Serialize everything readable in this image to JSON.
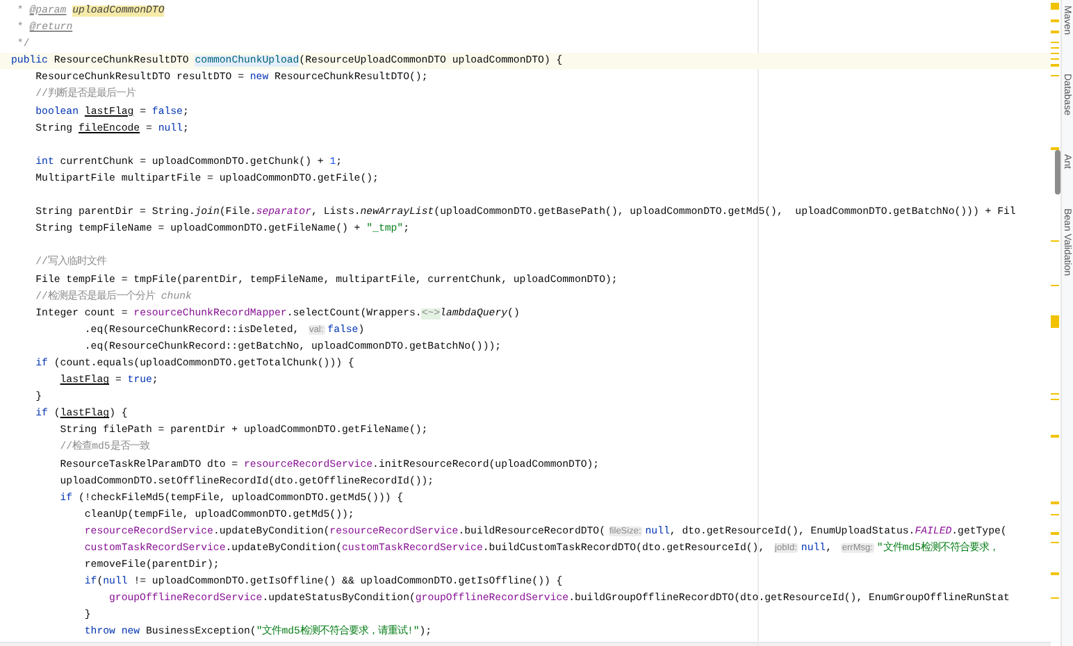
{
  "editor": {
    "lines": [
      {
        "current": false,
        "tokens": [
          {
            "kind": "comment",
            "text": " * "
          },
          {
            "kind": "doctag",
            "text": "@param"
          },
          {
            "kind": "docref",
            "text": " uploadCommonDTO"
          }
        ]
      },
      {
        "current": false,
        "tokens": [
          {
            "kind": "comment",
            "text": " * "
          },
          {
            "kind": "doctag",
            "text": "@return"
          }
        ]
      },
      {
        "current": false,
        "tokens": [
          {
            "kind": "comment",
            "text": " */"
          }
        ]
      },
      {
        "current": true,
        "tokens": [
          {
            "kind": "keyword",
            "text": "public"
          },
          {
            "kind": "plain",
            "text": " ResourceChunkResultDTO "
          },
          {
            "kind": "decl",
            "text": "commonChunkUpload"
          },
          {
            "kind": "plain",
            "text": "(ResourceUploadCommonDTO uploadCommonDTO) {"
          }
        ]
      },
      {
        "current": false,
        "tokens": [
          {
            "kind": "plain",
            "text": "    ResourceChunkResultDTO resultDTO = "
          },
          {
            "kind": "keyword",
            "text": "new"
          },
          {
            "kind": "plain",
            "text": " ResourceChunkResultDTO();"
          }
        ]
      },
      {
        "current": false,
        "tokens": [
          {
            "kind": "comment",
            "text": "    //判断是否是最后一片"
          }
        ]
      },
      {
        "current": false,
        "tokens": [
          {
            "kind": "keyword",
            "text": "    boolean "
          },
          {
            "kind": "underline",
            "text": "lastFlag"
          },
          {
            "kind": "plain",
            "text": " = "
          },
          {
            "kind": "keyword",
            "text": "false"
          },
          {
            "kind": "plain",
            "text": ";"
          }
        ]
      },
      {
        "current": false,
        "tokens": [
          {
            "kind": "plain",
            "text": "    String "
          },
          {
            "kind": "underline",
            "text": "fileEncode"
          },
          {
            "kind": "plain",
            "text": " = "
          },
          {
            "kind": "keyword",
            "text": "null"
          },
          {
            "kind": "plain",
            "text": ";"
          }
        ]
      },
      {
        "current": false
      },
      {
        "current": false,
        "tokens": [
          {
            "kind": "keyword",
            "text": "    int"
          },
          {
            "kind": "plain",
            "text": " currentChunk = uploadCommonDTO.getChunk() + "
          },
          {
            "kind": "number",
            "text": "1"
          },
          {
            "kind": "plain",
            "text": ";"
          }
        ]
      },
      {
        "current": false,
        "tokens": [
          {
            "kind": "plain",
            "text": "    MultipartFile multipartFile = uploadCommonDTO.getFile();"
          }
        ]
      },
      {
        "current": false
      },
      {
        "current": false,
        "tokens": [
          {
            "kind": "plain",
            "text": "    String parentDir = String."
          },
          {
            "kind": "static",
            "text": "join"
          },
          {
            "kind": "plain",
            "text": "(File."
          },
          {
            "kind": "static_field",
            "text": "separator"
          },
          {
            "kind": "plain",
            "text": ", Lists."
          },
          {
            "kind": "static",
            "text": "newArrayList"
          },
          {
            "kind": "plain",
            "text": "(uploadCommonDTO.getBasePath(), uploadCommonDTO.getMd5(),  uploadCommonDTO.getBatchNo())) + Fil"
          }
        ]
      },
      {
        "current": false,
        "tokens": [
          {
            "kind": "plain",
            "text": "    String tempFileName = uploadCommonDTO.getFileName() + "
          },
          {
            "kind": "string",
            "text": "\"_tmp\""
          },
          {
            "kind": "plain",
            "text": ";"
          }
        ]
      },
      {
        "current": false
      },
      {
        "current": false,
        "tokens": [
          {
            "kind": "comment",
            "text": "    //写入临时文件"
          }
        ]
      },
      {
        "current": false,
        "tokens": [
          {
            "kind": "plain",
            "text": "    File tempFile = tmpFile(parentDir, tempFileName, multipartFile, currentChunk, uploadCommonDTO);"
          }
        ]
      },
      {
        "current": false,
        "tokens": [
          {
            "kind": "comment",
            "text": "    //检测是否是最后一个分片 "
          },
          {
            "kind": "comment_em",
            "text": "chunk"
          }
        ]
      },
      {
        "current": false,
        "tokens": [
          {
            "kind": "plain",
            "text": "    Integer count = "
          },
          {
            "kind": "field",
            "text": "resourceChunkRecordMapper"
          },
          {
            "kind": "plain",
            "text": ".selectCount(Wrappers."
          },
          {
            "kind": "infer",
            "text": "<~>"
          },
          {
            "kind": "static",
            "text": "lambdaQuery"
          },
          {
            "kind": "plain",
            "text": "()"
          }
        ]
      },
      {
        "current": false,
        "tokens": [
          {
            "kind": "plain",
            "text": "            .eq(ResourceChunkRecord::isDeleted, "
          },
          {
            "kind": "hint",
            "text": "val:"
          },
          {
            "kind": "keyword",
            "text": "false"
          },
          {
            "kind": "plain",
            "text": ")"
          }
        ]
      },
      {
        "current": false,
        "tokens": [
          {
            "kind": "plain",
            "text": "            .eq(ResourceChunkRecord::getBatchNo, uploadCommonDTO.getBatchNo()));"
          }
        ]
      },
      {
        "current": false,
        "tokens": [
          {
            "kind": "keyword",
            "text": "    if"
          },
          {
            "kind": "plain",
            "text": " (count.equals(uploadCommonDTO.getTotalChunk())) {"
          }
        ]
      },
      {
        "current": false,
        "tokens": [
          {
            "kind": "underline",
            "text": "        lastFlag"
          },
          {
            "kind": "plain",
            "text": " = "
          },
          {
            "kind": "keyword",
            "text": "true"
          },
          {
            "kind": "plain",
            "text": ";"
          }
        ]
      },
      {
        "current": false,
        "tokens": [
          {
            "kind": "plain",
            "text": "    }"
          }
        ]
      },
      {
        "current": false,
        "tokens": [
          {
            "kind": "keyword",
            "text": "    if"
          },
          {
            "kind": "plain",
            "text": " ("
          },
          {
            "kind": "underline",
            "text": "lastFlag"
          },
          {
            "kind": "plain",
            "text": ") {"
          }
        ]
      },
      {
        "current": false,
        "tokens": [
          {
            "kind": "plain",
            "text": "        String filePath = parentDir + uploadCommonDTO.getFileName();"
          }
        ]
      },
      {
        "current": false,
        "tokens": [
          {
            "kind": "comment",
            "text": "        //检查md5是否一致"
          }
        ]
      },
      {
        "current": false,
        "tokens": [
          {
            "kind": "plain",
            "text": "        ResourceTaskRelParamDTO dto = "
          },
          {
            "kind": "field",
            "text": "resourceRecordService"
          },
          {
            "kind": "plain",
            "text": ".initResourceRecord(uploadCommonDTO);"
          }
        ]
      },
      {
        "current": false,
        "tokens": [
          {
            "kind": "plain",
            "text": "        uploadCommonDTO.setOfflineRecordId(dto.getOfflineRecordId());"
          }
        ]
      },
      {
        "current": false,
        "tokens": [
          {
            "kind": "keyword",
            "text": "        if"
          },
          {
            "kind": "plain",
            "text": " (!checkFileMd5(tempFile, uploadCommonDTO.getMd5())) {"
          }
        ]
      },
      {
        "current": false,
        "tokens": [
          {
            "kind": "plain",
            "text": "            cleanUp(tempFile, uploadCommonDTO.getMd5());"
          }
        ]
      },
      {
        "current": false,
        "tokens": [
          {
            "kind": "field",
            "text": "            resourceRecordService"
          },
          {
            "kind": "plain",
            "text": ".updateByCondition("
          },
          {
            "kind": "field",
            "text": "resourceRecordService"
          },
          {
            "kind": "plain",
            "text": ".buildResourceRecordDTO("
          },
          {
            "kind": "hint",
            "text": "fileSize:"
          },
          {
            "kind": "keyword",
            "text": "null"
          },
          {
            "kind": "plain",
            "text": ", dto.getResourceId(), EnumUploadStatus."
          },
          {
            "kind": "static_field",
            "text": "FAILED"
          },
          {
            "kind": "plain",
            "text": ".getType("
          }
        ]
      },
      {
        "current": false,
        "tokens": [
          {
            "kind": "field",
            "text": "            customTaskRecordService"
          },
          {
            "kind": "plain",
            "text": ".updateByCondition("
          },
          {
            "kind": "field",
            "text": "customTaskRecordService"
          },
          {
            "kind": "plain",
            "text": ".buildCustomTaskRecordDTO(dto.getResourceId(), "
          },
          {
            "kind": "hint",
            "text": "jobId:"
          },
          {
            "kind": "keyword",
            "text": "null"
          },
          {
            "kind": "plain",
            "text": ", "
          },
          {
            "kind": "hint",
            "text": "errMsg:"
          },
          {
            "kind": "string",
            "text": "\"文件md5检测不符合要求，"
          }
        ]
      },
      {
        "current": false,
        "tokens": [
          {
            "kind": "plain",
            "text": "            removeFile(parentDir);"
          }
        ]
      },
      {
        "current": false,
        "tokens": [
          {
            "kind": "keyword",
            "text": "            if"
          },
          {
            "kind": "plain",
            "text": "("
          },
          {
            "kind": "keyword",
            "text": "null"
          },
          {
            "kind": "plain",
            "text": " != uploadCommonDTO.getIsOffline() && uploadCommonDTO.getIsOffline()) {"
          }
        ]
      },
      {
        "current": false,
        "tokens": [
          {
            "kind": "field",
            "text": "                groupOfflineRecordService"
          },
          {
            "kind": "plain",
            "text": ".updateStatusByCondition("
          },
          {
            "kind": "field",
            "text": "groupOfflineRecordService"
          },
          {
            "kind": "plain",
            "text": ".buildGroupOfflineRecordDTO(dto.getResourceId(), EnumGroupOfflineRunStat"
          }
        ]
      },
      {
        "current": false,
        "tokens": [
          {
            "kind": "plain",
            "text": "            }"
          }
        ]
      },
      {
        "current": false,
        "tokens": [
          {
            "kind": "keyword",
            "text": "            throw new"
          },
          {
            "kind": "plain",
            "text": " BusinessException("
          },
          {
            "kind": "string",
            "text": "\"文件md5检测不符合要求，请重试!\""
          },
          {
            "kind": "plain",
            "text": ");"
          }
        ]
      }
    ]
  },
  "tool_stripe": {
    "tabs": [
      {
        "label": "Maven"
      },
      {
        "label": "Database"
      },
      {
        "label": "Ant"
      },
      {
        "label": "Bean Validation"
      }
    ]
  }
}
